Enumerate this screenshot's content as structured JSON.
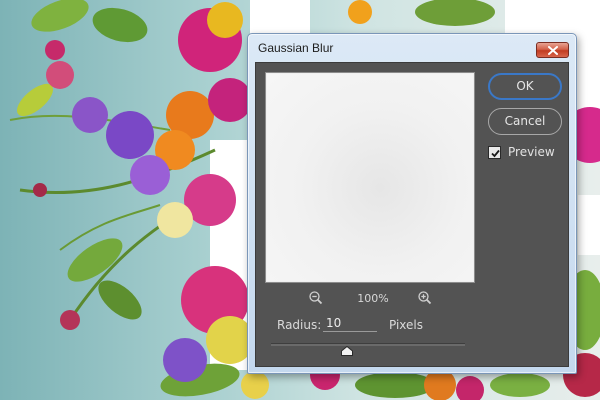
{
  "dialog": {
    "title": "Gaussian Blur",
    "close_icon": "close-icon",
    "zoom": {
      "zoom_out_icon": "zoom-out-icon",
      "zoom_in_icon": "zoom-in-icon",
      "level": "100%"
    },
    "radius": {
      "label": "Radius:",
      "value": "10",
      "units": "Pixels",
      "slider_fraction": 0.39
    },
    "buttons": {
      "ok": "OK",
      "cancel": "Cancel"
    },
    "preview": {
      "label": "Preview",
      "checked": true
    }
  },
  "colors": {
    "client_background": "#535353",
    "ok_focus_ring": "#3a78c8",
    "close_button": "#c84a33",
    "title_bar": "#c9dcf0"
  }
}
